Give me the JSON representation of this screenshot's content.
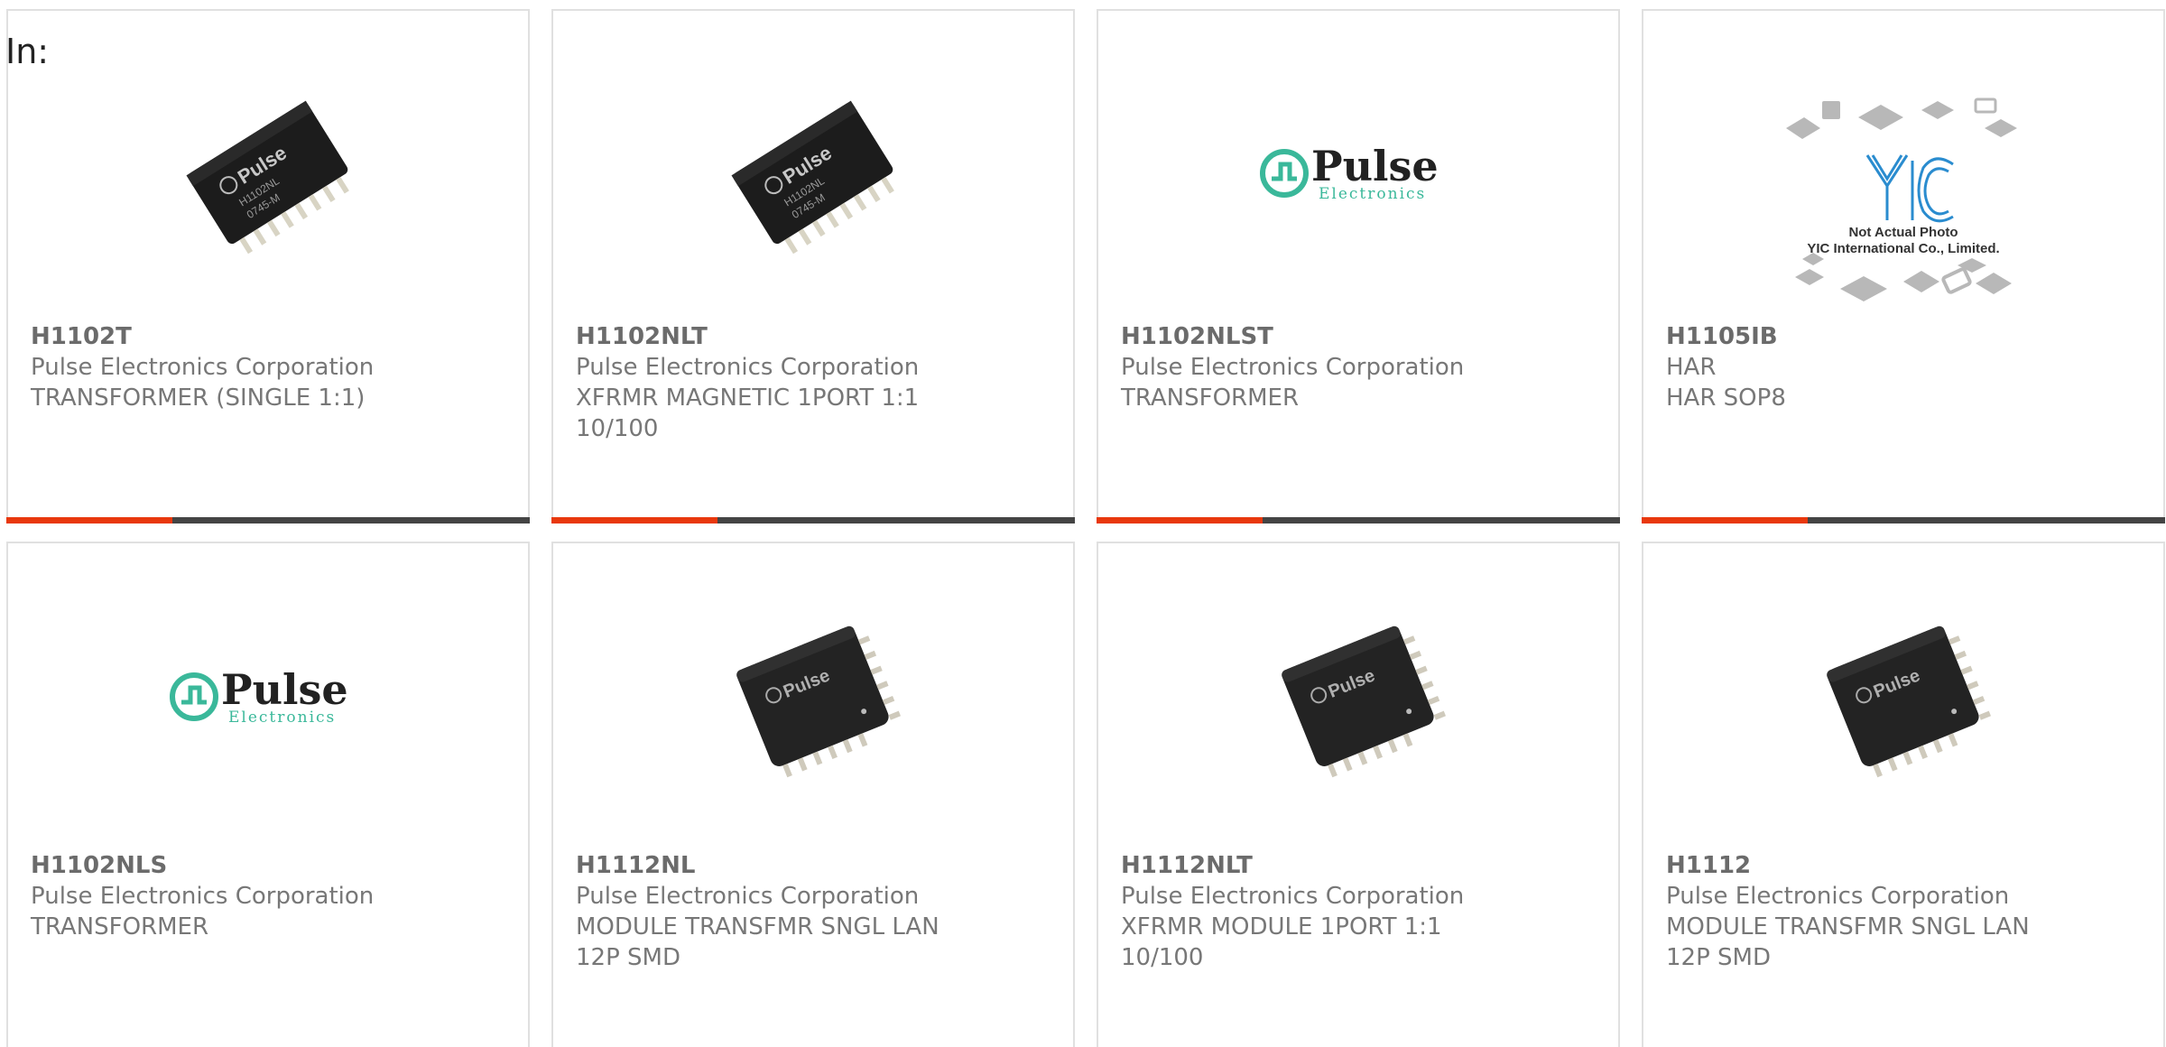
{
  "header": {
    "label": "In:"
  },
  "colors": {
    "accent": "#e8380d",
    "bar": "#444444",
    "pulse_teal": "#3ab89a"
  },
  "products": [
    {
      "part": "H1102T",
      "manufacturer": "Pulse Electronics Corporation",
      "description": "TRANSFORMER (SINGLE 1:1)",
      "image": "smd-transformer-photo"
    },
    {
      "part": "H1102NLT",
      "manufacturer": "Pulse Electronics Corporation",
      "description": "XFRMR MAGNETIC 1PORT 1:1 10/100",
      "image": "smd-transformer-photo"
    },
    {
      "part": "H1102NLST",
      "manufacturer": "Pulse Electronics Corporation",
      "description": "TRANSFORMER",
      "image": "pulse-logo"
    },
    {
      "part": "H1105IB",
      "manufacturer": "HAR",
      "description": "HAR SOP8",
      "image": "yic-placeholder",
      "placeholder_text": [
        "Not Actual Photo",
        "YIC International Co., Limited."
      ]
    },
    {
      "part": "H1102NLS",
      "manufacturer": "Pulse Electronics Corporation",
      "description": "TRANSFORMER",
      "image": "pulse-logo"
    },
    {
      "part": "H1112NL",
      "manufacturer": "Pulse Electronics Corporation",
      "description": "MODULE TRANSFMR SNGL LAN 12P SMD",
      "image": "smd-module-photo"
    },
    {
      "part": "H1112NLT",
      "manufacturer": "Pulse Electronics Corporation",
      "description": "XFRMR MODULE 1PORT 1:1 10/100",
      "image": "smd-module-photo"
    },
    {
      "part": "H1112",
      "manufacturer": "Pulse Electronics Corporation",
      "description": "MODULE TRANSFMR SNGL LAN 12P SMD",
      "image": "smd-module-photo"
    }
  ],
  "logo": {
    "word": "Pulse",
    "sub": "Electronics"
  },
  "chip_marking": {
    "brand": "Pulse",
    "line1": "H1102NL",
    "line2": "0745-M"
  }
}
